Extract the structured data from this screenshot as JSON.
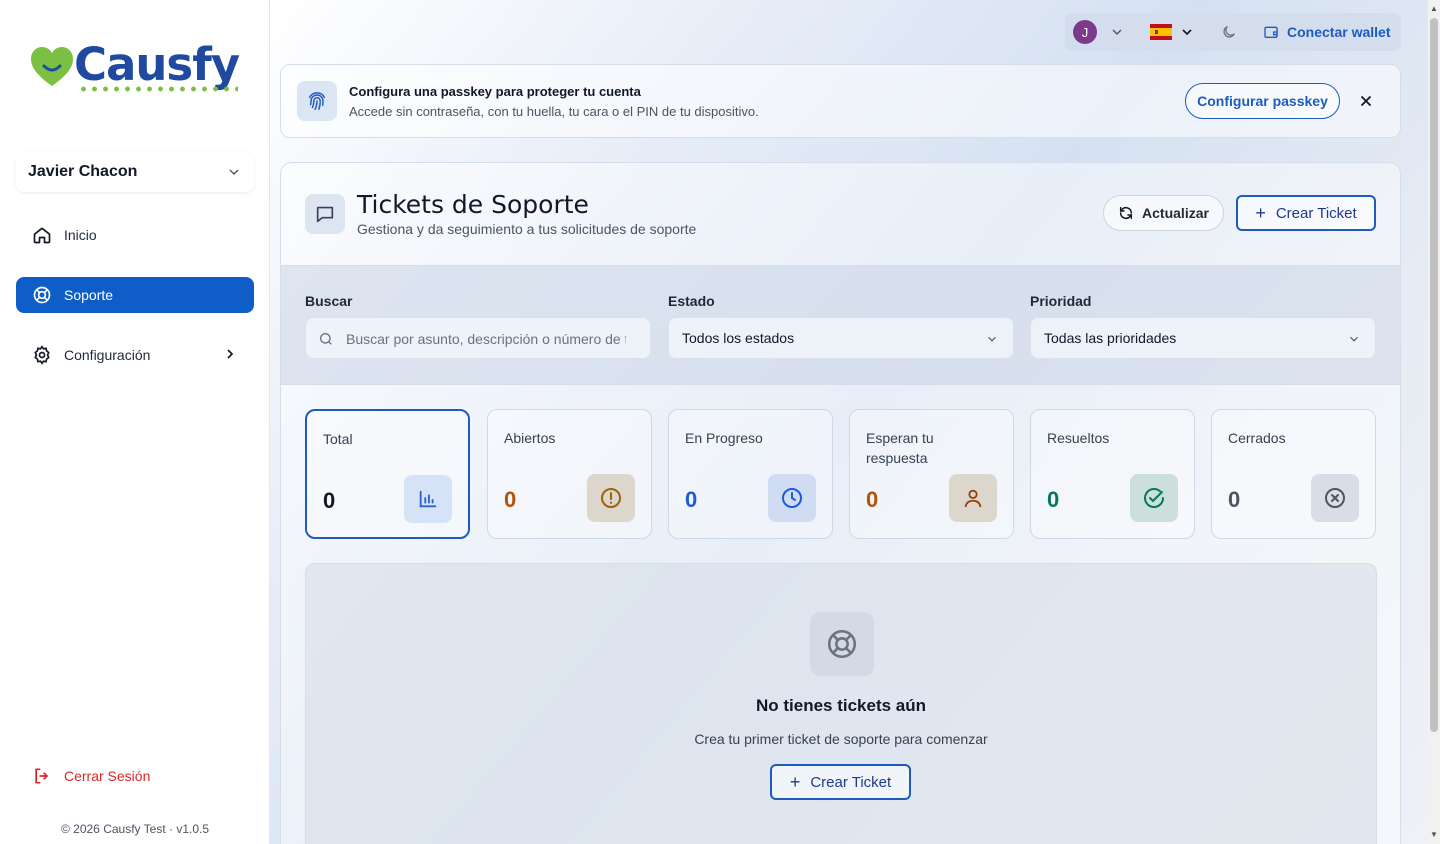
{
  "brand": {
    "name": "Causfy"
  },
  "user": {
    "name": "Javier Chacon",
    "initial": "J"
  },
  "sidebar": {
    "items": [
      {
        "label": "Inicio",
        "icon": "home-icon"
      },
      {
        "label": "Soporte",
        "icon": "lifebuoy-icon",
        "active": true
      },
      {
        "label": "Configuración",
        "icon": "gear-icon"
      }
    ],
    "logout": "Cerrar Sesión",
    "footer": "© 2026 Causfy Test · v1.0.5"
  },
  "topbar": {
    "language_flag": "spain-flag-icon",
    "theme_icon": "moon-icon",
    "wallet_label": "Conectar wallet"
  },
  "banner": {
    "title": "Configura una passkey para proteger tu cuenta",
    "description": "Accede sin contraseña, con tu huella, tu cara o el PIN de tu dispositivo.",
    "button": "Configurar passkey"
  },
  "page": {
    "title": "Tickets de Soporte",
    "subtitle": "Gestiona y da seguimiento a tus solicitudes de soporte",
    "refresh_label": "Actualizar",
    "create_label": "Crear Ticket"
  },
  "filters": {
    "search": {
      "label": "Buscar",
      "placeholder": "Buscar por asunto, descripción o número de ticket"
    },
    "status": {
      "label": "Estado",
      "value": "Todos los estados"
    },
    "priority": {
      "label": "Prioridad",
      "value": "Todas las prioridades"
    }
  },
  "stats": [
    {
      "label": "Total",
      "value": "0",
      "color": "#111827",
      "icon_bg": "#d6e2f5",
      "icon_color": "#2a63c9"
    },
    {
      "label": "Abiertos",
      "value": "0",
      "color": "#b45309",
      "icon_bg": "#ddd6cc",
      "icon_color": "#a16207"
    },
    {
      "label": "En Progreso",
      "value": "0",
      "color": "#1d5bd8",
      "icon_bg": "#cfdcf2",
      "icon_color": "#1d5bd8"
    },
    {
      "label": "Esperan tu respuesta",
      "value": "0",
      "color": "#b45309",
      "icon_bg": "#ddd6cc",
      "icon_color": "#92400e"
    },
    {
      "label": "Resueltos",
      "value": "0",
      "color": "#047857",
      "icon_bg": "#cddfdc",
      "icon_color": "#047857"
    },
    {
      "label": "Cerrados",
      "value": "0",
      "color": "#4b5563",
      "icon_bg": "#d9dee6",
      "icon_color": "#4b5563"
    }
  ],
  "empty_state": {
    "title": "No tienes tickets aún",
    "subtitle": "Crea tu primer ticket de soporte para comenzar",
    "button": "Crear Ticket"
  }
}
